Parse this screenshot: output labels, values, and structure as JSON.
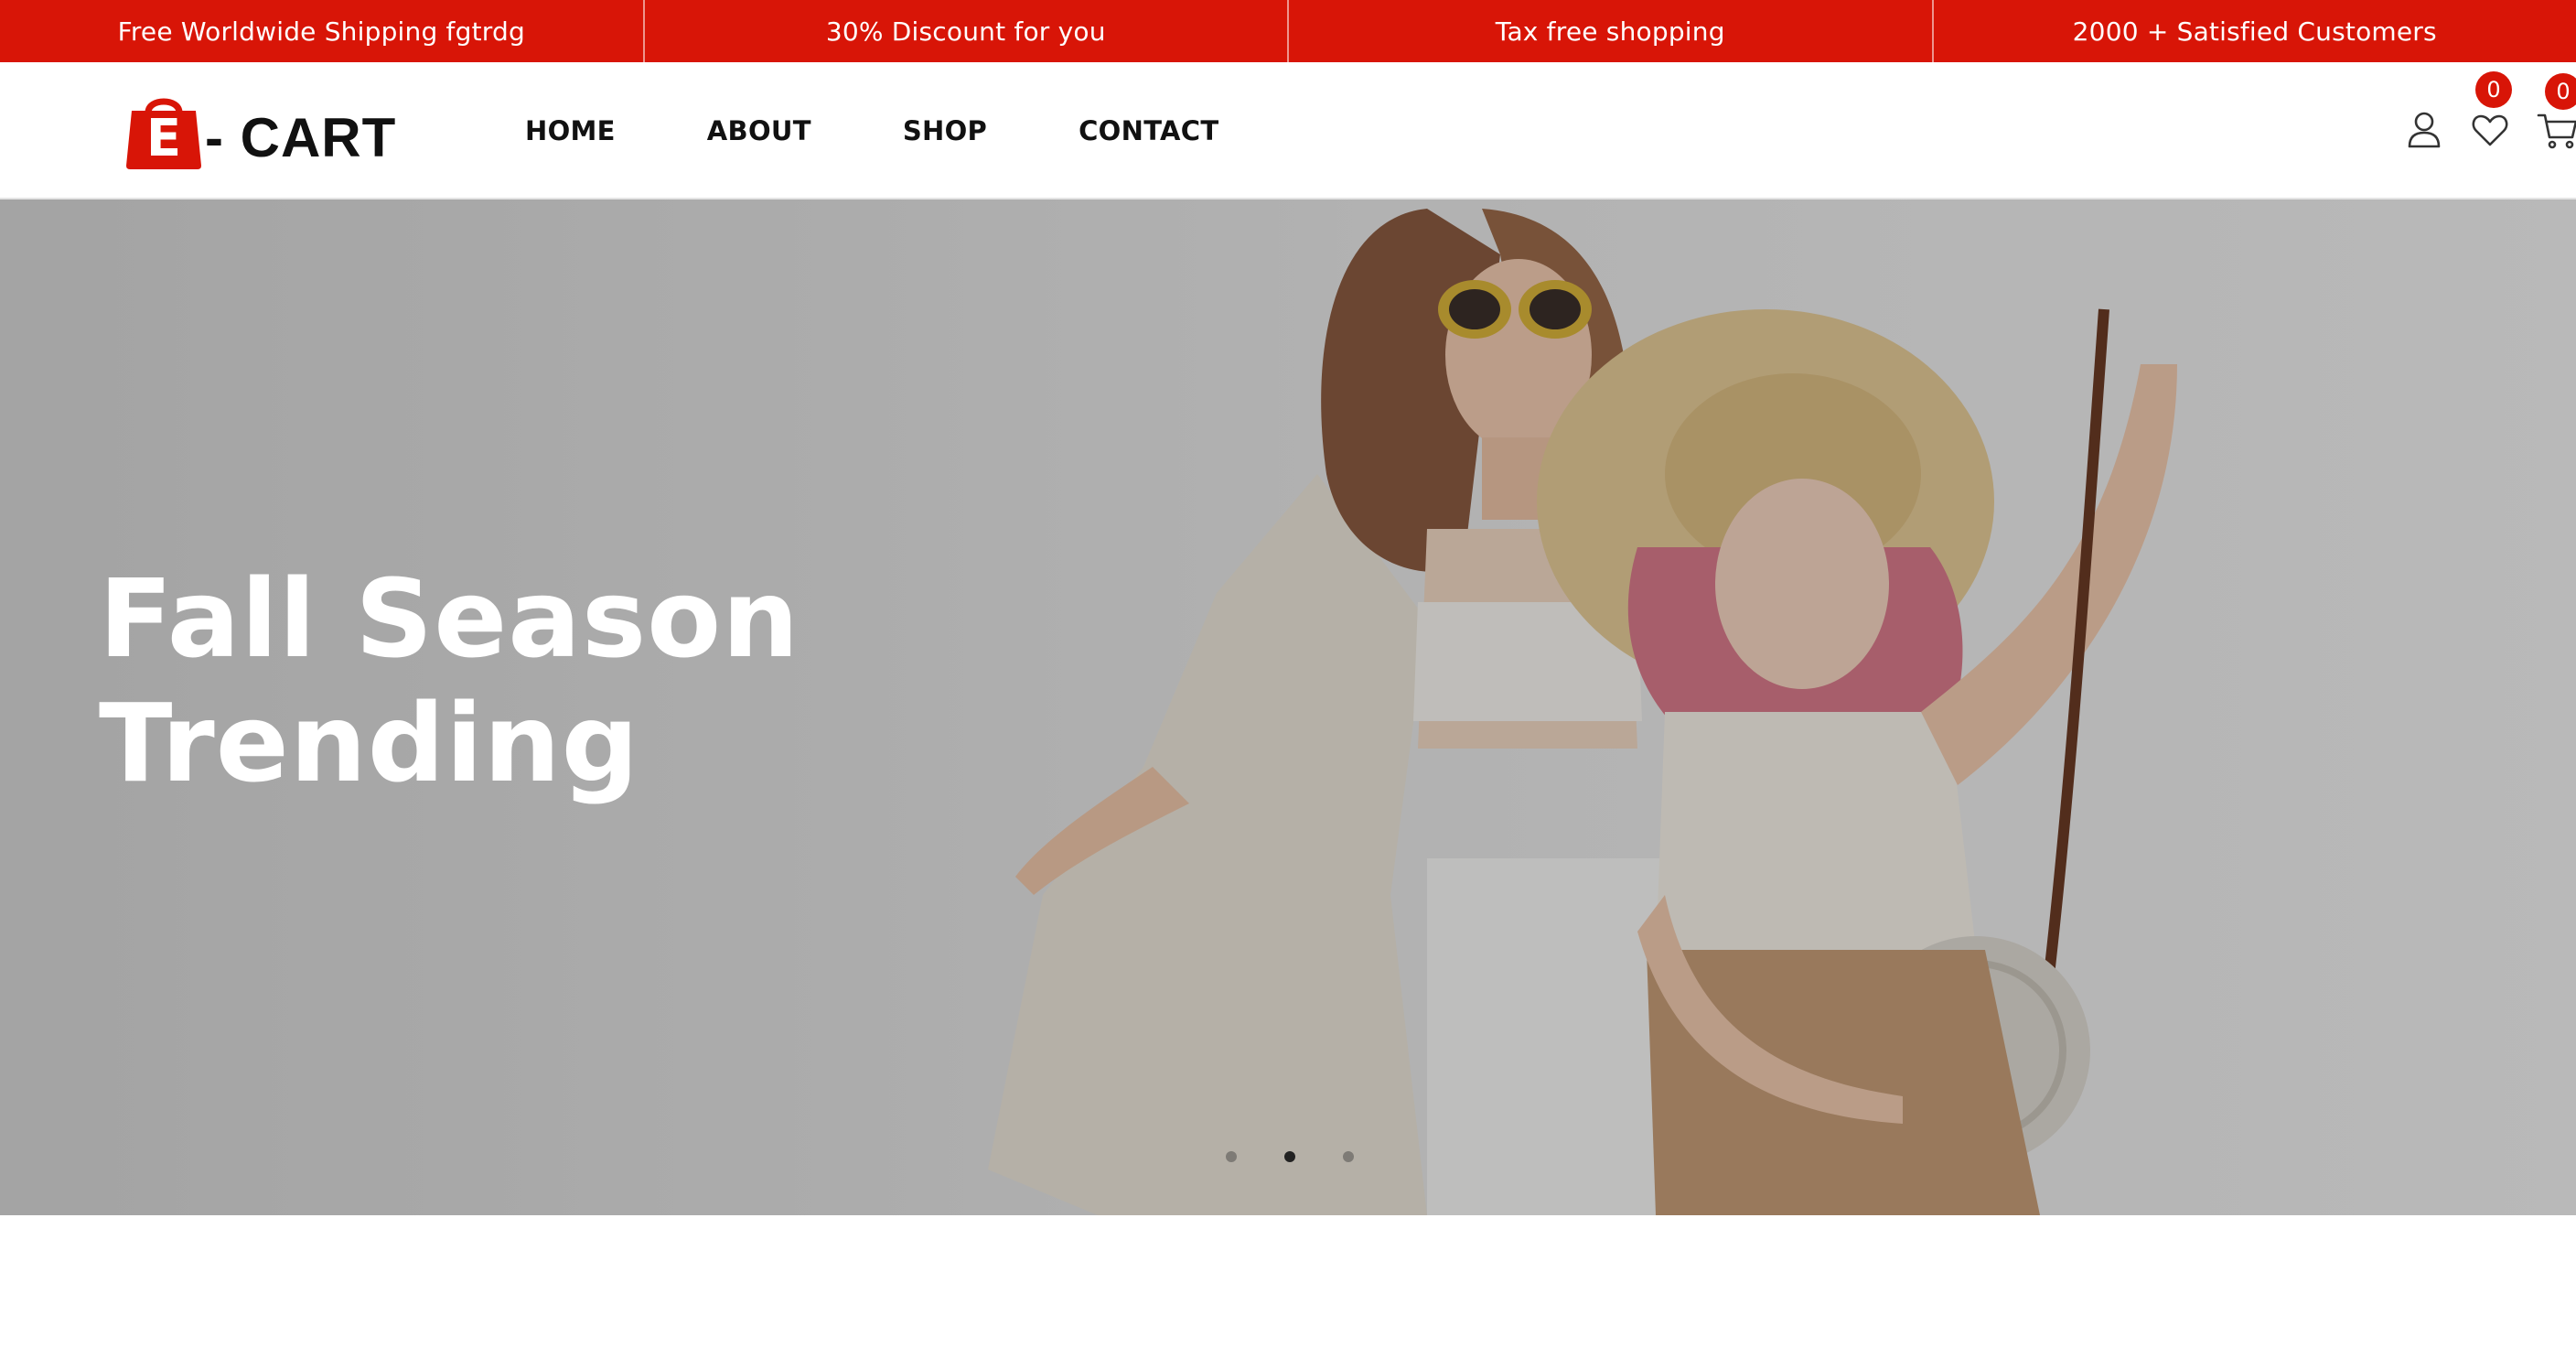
{
  "promo_bar": {
    "items": [
      "Free Worldwide Shipping fgtrdg",
      "30% Discount for you",
      "Tax free shopping",
      "2000 + Satisfied Customers"
    ]
  },
  "header": {
    "logo": {
      "letter": "E",
      "text": "- CART"
    },
    "nav": [
      "HOME",
      "ABOUT",
      "SHOP",
      "CONTACT"
    ],
    "icons": {
      "account": "user-icon",
      "wishlist": "heart-icon",
      "cart": "cart-icon"
    },
    "wishlist_count": "0",
    "cart_count": "0"
  },
  "hero": {
    "title_line1": "Fall Season",
    "title_line2": "Trending",
    "slides_total": 3,
    "active_slide": 2
  },
  "colors": {
    "brand_red": "#d81507",
    "text_dark": "#111111",
    "white": "#ffffff"
  }
}
